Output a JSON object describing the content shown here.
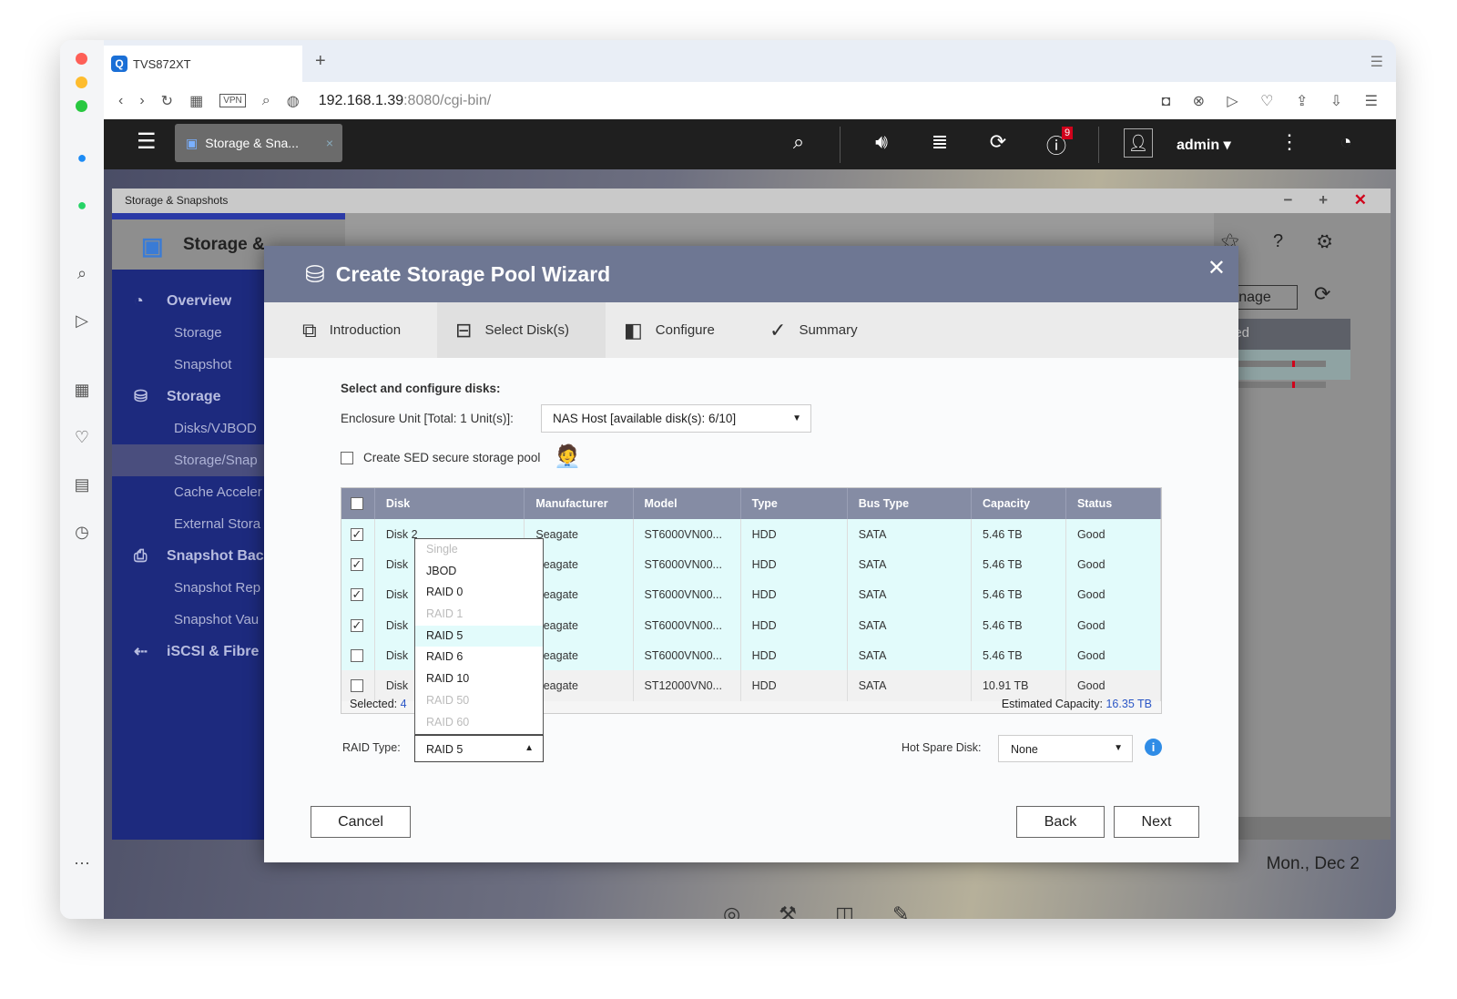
{
  "browser": {
    "tab_title": "TVS872XT",
    "new_tab": "+",
    "url_host": "192.168.1.39",
    "url_rest": ":8080/cgi-bin/",
    "vpn": "VPN"
  },
  "qts": {
    "app_tab": "Storage & Sna...",
    "user": "admin",
    "notification_count": "9"
  },
  "app": {
    "window_title": "Storage & Snapshots",
    "header": "Storage &",
    "manage": "Manage",
    "used": "Used",
    "date": "Mon., Dec 2",
    "sidebar": [
      {
        "label": "Overview",
        "group": true
      },
      {
        "label": "Storage"
      },
      {
        "label": "Snapshot"
      },
      {
        "label": "Storage",
        "group": true
      },
      {
        "label": "Disks/VJBOD"
      },
      {
        "label": "Storage/Snap",
        "active": true
      },
      {
        "label": "Cache Acceler"
      },
      {
        "label": "External Stora"
      },
      {
        "label": "Snapshot Bac",
        "group": true
      },
      {
        "label": "Snapshot Rep"
      },
      {
        "label": "Snapshot Vau"
      },
      {
        "label": "iSCSI & Fibre",
        "group": true
      }
    ]
  },
  "wizard": {
    "title": "Create Storage Pool Wizard",
    "steps": [
      {
        "label": "Introduction"
      },
      {
        "label": "Select Disk(s)",
        "current": true
      },
      {
        "label": "Configure"
      },
      {
        "label": "Summary"
      }
    ],
    "section_label": "Select and configure disks:",
    "enclosure_label": "Enclosure Unit [Total: 1 Unit(s)]:",
    "enclosure_value": "NAS Host [available disk(s): 6/10]",
    "sed_label": "Create SED secure storage pool",
    "columns": [
      "Disk",
      "Manufacturer",
      "Model",
      "Type",
      "Bus Type",
      "Capacity",
      "Status"
    ],
    "rows": [
      {
        "checked": true,
        "disk": "Disk 2",
        "manufacturer": "Seagate",
        "model": "ST6000VN00...",
        "type": "HDD",
        "bus": "SATA",
        "capacity": "5.46 TB",
        "status": "Good"
      },
      {
        "checked": true,
        "disk": "Disk",
        "manufacturer": "Seagate",
        "model": "ST6000VN00...",
        "type": "HDD",
        "bus": "SATA",
        "capacity": "5.46 TB",
        "status": "Good"
      },
      {
        "checked": true,
        "disk": "Disk",
        "manufacturer": "Seagate",
        "model": "ST6000VN00...",
        "type": "HDD",
        "bus": "SATA",
        "capacity": "5.46 TB",
        "status": "Good"
      },
      {
        "checked": true,
        "disk": "Disk",
        "manufacturer": "Seagate",
        "model": "ST6000VN00...",
        "type": "HDD",
        "bus": "SATA",
        "capacity": "5.46 TB",
        "status": "Good"
      },
      {
        "checked": false,
        "disk": "Disk",
        "manufacturer": "Seagate",
        "model": "ST6000VN00...",
        "type": "HDD",
        "bus": "SATA",
        "capacity": "5.46 TB",
        "status": "Good"
      },
      {
        "checked": false,
        "disk": "Disk",
        "manufacturer": "Seagate",
        "model": "ST12000VN0...",
        "type": "HDD",
        "bus": "SATA",
        "capacity": "10.91 TB",
        "status": "Good"
      }
    ],
    "selected_label": "Selected:",
    "selected_count": "4",
    "estimated_label": "Estimated Capacity:",
    "estimated_value": "16.35 TB",
    "raid_label": "RAID Type:",
    "raid_value": "RAID 5",
    "raid_options": [
      {
        "label": "Single",
        "disabled": true
      },
      {
        "label": "JBOD"
      },
      {
        "label": "RAID 0"
      },
      {
        "label": "RAID 1",
        "disabled": true
      },
      {
        "label": "RAID 5",
        "highlighted": true
      },
      {
        "label": "RAID 6"
      },
      {
        "label": "RAID 10"
      },
      {
        "label": "RAID 50",
        "disabled": true
      },
      {
        "label": "RAID 60",
        "disabled": true
      }
    ],
    "hot_spare_label": "Hot Spare Disk:",
    "hot_spare_value": "None",
    "cancel": "Cancel",
    "back": "Back",
    "next": "Next"
  },
  "colors": {
    "accent_link": "#2a56c6",
    "sidebar": "#1d2a7e",
    "wizard_header": "#6e7793",
    "selected_row": "#e2fbfb",
    "badge": "#d0021b"
  }
}
